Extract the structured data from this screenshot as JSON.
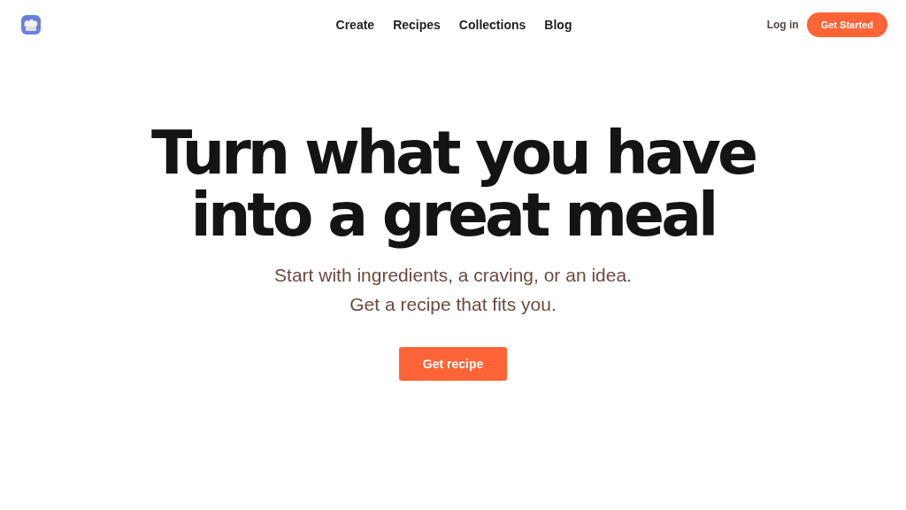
{
  "nav": {
    "links": [
      "Create",
      "Recipes",
      "Collections",
      "Blog"
    ],
    "login": "Log in",
    "cta": "Get Started"
  },
  "hero": {
    "title_lines": [
      "Turn what you have",
      "into a great meal"
    ],
    "subtitle_lines": [
      "Start with ingredients, a craving, or an idea.",
      "Get a recipe that fits you."
    ],
    "button": "Get recipe"
  }
}
